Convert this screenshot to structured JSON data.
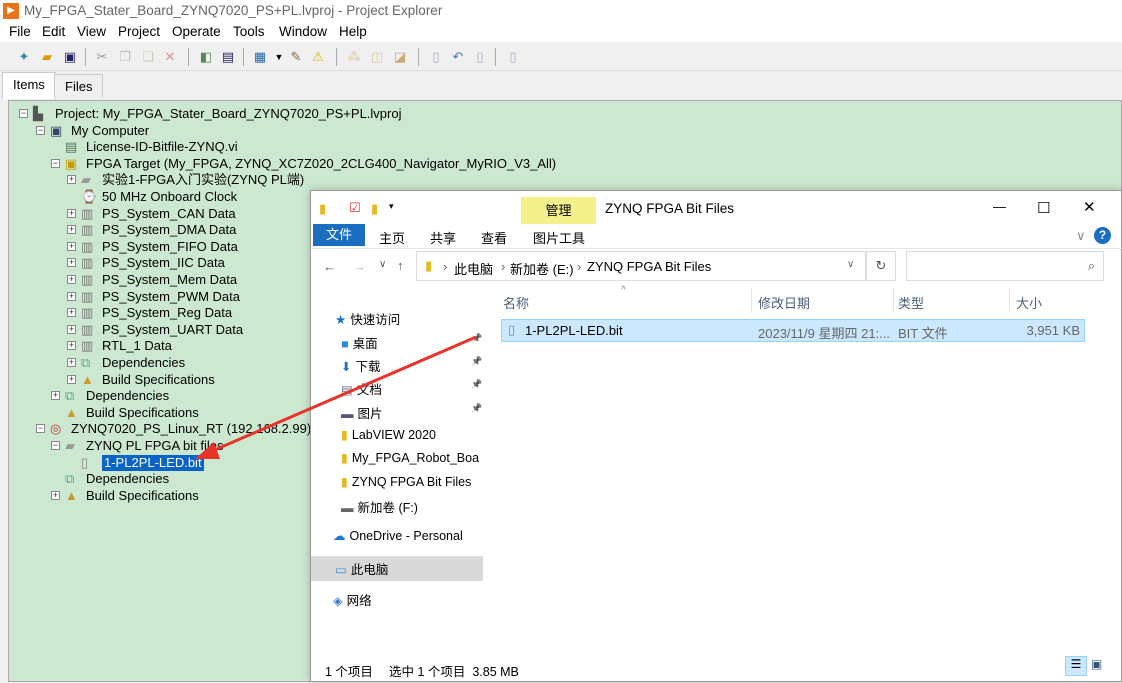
{
  "window": {
    "title": "My_FPGA_Stater_Board_ZYNQ7020_PS+PL.lvproj - Project Explorer"
  },
  "menu": [
    "File",
    "Edit",
    "View",
    "Project",
    "Operate",
    "Tools",
    "Window",
    "Help"
  ],
  "tabs": {
    "items": "Items",
    "files": "Files"
  },
  "tree": [
    {
      "label": "Project: My_FPGA_Stater_Board_ZYNQ7020_PS+PL.lvproj",
      "level": 0,
      "icon": "project-icon",
      "expander": "minus"
    },
    {
      "label": "My Computer",
      "level": 1,
      "icon": "computer-icon",
      "expander": "minus"
    },
    {
      "label": "License-ID-Bitfile-ZYNQ.vi",
      "level": 2,
      "icon": "vi-icon",
      "expander": "none"
    },
    {
      "label": "FPGA Target (My_FPGA, ZYNQ_XC7Z020_2CLG400_Navigator_MyRIO_V3_All)",
      "level": 2,
      "icon": "fpga-target-icon",
      "expander": "minus"
    },
    {
      "label": "实验1-FPGA入门实验(ZYNQ PL端)",
      "level": 3,
      "icon": "folder-icon",
      "expander": "plus"
    },
    {
      "label": "50 MHz Onboard Clock",
      "level": 3,
      "icon": "clock-icon",
      "expander": "none"
    },
    {
      "label": "PS_System_CAN Data",
      "level": 3,
      "icon": "memory-icon",
      "expander": "plus"
    },
    {
      "label": "PS_System_DMA Data",
      "level": 3,
      "icon": "memory-icon",
      "expander": "plus"
    },
    {
      "label": "PS_System_FIFO Data",
      "level": 3,
      "icon": "memory-icon",
      "expander": "plus"
    },
    {
      "label": "PS_System_IIC Data",
      "level": 3,
      "icon": "memory-icon",
      "expander": "plus"
    },
    {
      "label": "PS_System_Mem Data",
      "level": 3,
      "icon": "memory-icon",
      "expander": "plus"
    },
    {
      "label": "PS_System_PWM Data",
      "level": 3,
      "icon": "memory-icon",
      "expander": "plus"
    },
    {
      "label": "PS_System_Reg Data",
      "level": 3,
      "icon": "memory-icon",
      "expander": "plus"
    },
    {
      "label": "PS_System_UART Data",
      "level": 3,
      "icon": "memory-icon",
      "expander": "plus"
    },
    {
      "label": "RTL_1 Data",
      "level": 3,
      "icon": "memory-icon",
      "expander": "plus"
    },
    {
      "label": "Dependencies",
      "level": 3,
      "icon": "dependencies-icon",
      "expander": "plus"
    },
    {
      "label": "Build Specifications",
      "level": 3,
      "icon": "build-icon",
      "expander": "plus"
    },
    {
      "label": "Dependencies",
      "level": 2,
      "icon": "dependencies-icon",
      "expander": "plus"
    },
    {
      "label": "Build Specifications",
      "level": 2,
      "icon": "build-icon",
      "expander": "none"
    },
    {
      "label": "ZYNQ7020_PS_Linux_RT (192.168.2.99)",
      "level": 1,
      "icon": "rt-target-icon",
      "expander": "minus"
    },
    {
      "label": "ZYNQ PL FPGA bit files",
      "level": 2,
      "icon": "folder-icon",
      "expander": "minus"
    },
    {
      "label": "1-PL2PL-LED.bit",
      "level": 3,
      "icon": "file-icon",
      "expander": "none",
      "selected": true
    },
    {
      "label": "Dependencies",
      "level": 2,
      "icon": "dependencies-icon",
      "expander": "none"
    },
    {
      "label": "Build Specifications",
      "level": 2,
      "icon": "build-icon",
      "expander": "plus"
    }
  ],
  "explorer": {
    "title": "ZYNQ FPGA Bit Files",
    "manage_tab": "管理",
    "ribbon": [
      "文件",
      "主页",
      "共享",
      "查看",
      "图片工具"
    ],
    "breadcrumb": [
      "此电脑",
      "新加卷 (E:)",
      "ZYNQ FPGA Bit Files"
    ],
    "search_placeholder": "",
    "nav": [
      {
        "label": "快速访问",
        "icon": "star-icon"
      },
      {
        "label": "桌面",
        "icon": "desktop-icon",
        "pinned": true
      },
      {
        "label": "下载",
        "icon": "download-icon",
        "pinned": true
      },
      {
        "label": "文档",
        "icon": "document-icon",
        "pinned": true
      },
      {
        "label": "图片",
        "icon": "picture-icon",
        "pinned": true
      },
      {
        "label": "LabVIEW 2020",
        "icon": "folder-icon"
      },
      {
        "label": "My_FPGA_Robot_Boa",
        "icon": "folder-icon"
      },
      {
        "label": "ZYNQ FPGA Bit Files",
        "icon": "folder-icon"
      },
      {
        "label": "新加卷 (F:)",
        "icon": "drive-icon"
      },
      {
        "label": "OneDrive - Personal",
        "icon": "cloud-icon"
      },
      {
        "label": "此电脑",
        "icon": "pc-icon",
        "selected": true
      },
      {
        "label": "网络",
        "icon": "network-icon"
      }
    ],
    "columns": [
      "名称",
      "修改日期",
      "类型",
      "大小"
    ],
    "files": [
      {
        "name": "1-PL2PL-LED.bit",
        "modified": "2023/11/9 星期四 21:...",
        "type": "BIT 文件",
        "size": "3,951 KB"
      }
    ],
    "status": {
      "count": "1 个项目",
      "selected": "选中 1 个项目  3.85 MB"
    }
  },
  "colors": {
    "tree_bg": "#cde8d0",
    "selection": "#0a64c8",
    "accent": "#1a6ec2",
    "arrow": "#e8332a"
  }
}
